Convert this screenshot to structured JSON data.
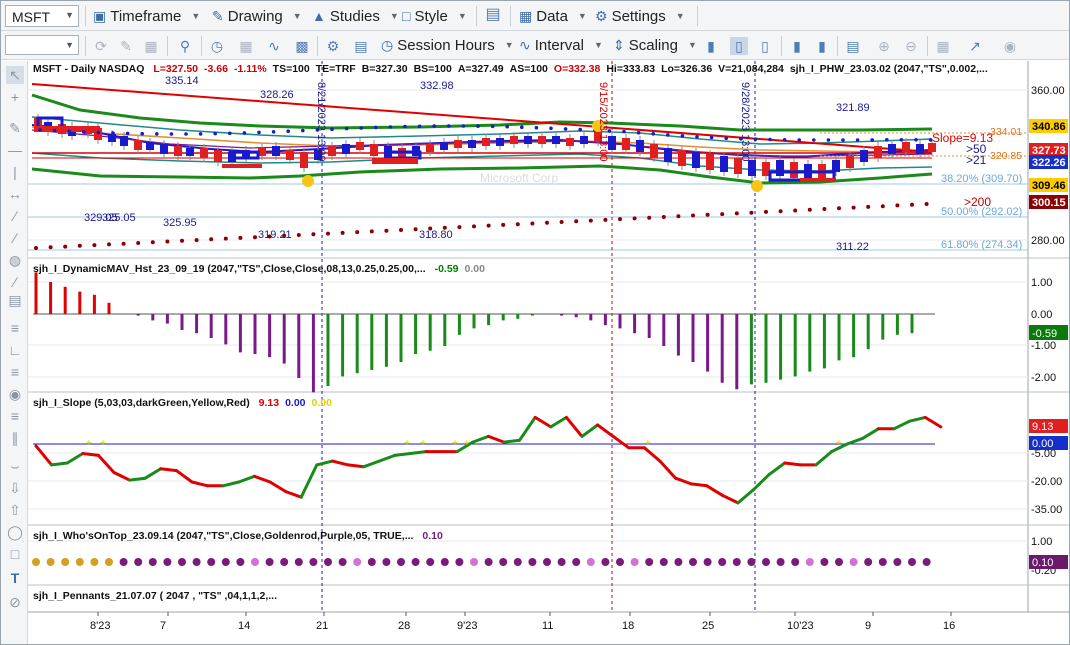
{
  "toolbar1": {
    "symbol": "MSFT",
    "menus": [
      {
        "name": "timeframe-menu",
        "icon": "calendar-icon",
        "label": "Timeframe"
      },
      {
        "name": "drawing-menu",
        "icon": "pencil-icon",
        "label": "Drawing"
      },
      {
        "name": "studies-menu",
        "icon": "flask-icon",
        "label": "Studies"
      },
      {
        "name": "style-menu",
        "icon": "style-icon",
        "label": "Style"
      },
      {
        "name": "data-menu",
        "icon": "table-icon",
        "label": "Data"
      },
      {
        "name": "settings-menu",
        "icon": "gear-icon",
        "label": "Settings"
      }
    ]
  },
  "toolbar2": {
    "session_label": "Session Hours",
    "interval_label": "Interval",
    "scaling_label": "Scaling"
  },
  "price_pane": {
    "title": "MSFT - Daily  NASDAQ",
    "stats": [
      {
        "text": "L=327.50",
        "color": "#d00000"
      },
      {
        "text": "-3.66",
        "color": "#d00000"
      },
      {
        "text": "-1.11%",
        "color": "#d00000"
      },
      {
        "text": "TS=100",
        "color": "#111"
      },
      {
        "text": "TE=TRF",
        "color": "#111"
      },
      {
        "text": "B=327.30",
        "color": "#111"
      },
      {
        "text": "BS=100",
        "color": "#111"
      },
      {
        "text": "A=327.49",
        "color": "#111"
      },
      {
        "text": "AS=100",
        "color": "#111"
      },
      {
        "text": "O=332.38",
        "color": "#d00000"
      },
      {
        "text": "Hi=333.83",
        "color": "#111"
      },
      {
        "text": "Lo=326.36",
        "color": "#111"
      },
      {
        "text": "V=21,084,284",
        "color": "#111"
      },
      {
        "text": "sjh_I_PHW_23.03.02 (2047,\"TS\",0.002,...",
        "color": "#111"
      }
    ],
    "watermark": "Microsoft Corp",
    "axis_ticks": [
      "360.00",
      "280.00"
    ],
    "price_labels": [
      {
        "text": "335.14",
        "color": "#1a1a8c"
      },
      {
        "text": "328.26",
        "color": "#1a1a8c"
      },
      {
        "text": "332.98",
        "color": "#1a1a8c"
      },
      {
        "text": "321.89",
        "color": "#1a1a8c"
      },
      {
        "text": "329.05",
        "color": "#1a1a8c"
      },
      {
        "text": "325.05",
        "color": "#1a1a8c"
      },
      {
        "text": "325.95",
        "color": "#1a1a8c"
      },
      {
        "text": "319.21",
        "color": "#1a1a8c"
      },
      {
        "text": "318.80",
        "color": "#1a1a8c"
      },
      {
        "text": "311.22",
        "color": "#1a1a8c"
      }
    ],
    "date_marks": [
      "8/21/2023 13:00",
      "9/15/2023 13:00",
      "9/28/2023 13:00"
    ],
    "fib_labels": [
      "38.20% (309.70)",
      "50.00% (292.02)",
      "61.80% (274.34)"
    ],
    "line_labels": [
      {
        "text": "334.01",
        "color": "#e0721a"
      },
      {
        "text": "320.85",
        "color": "#e0721a"
      }
    ],
    "annotations": [
      {
        "text": "Slope=9.13",
        "color": "#e00000"
      },
      {
        "text": ">21",
        "color": "#1a1a8c"
      },
      {
        "text": ">50",
        "color": "#1a1a8c"
      },
      {
        "text": ">200",
        "color": "#c00000"
      }
    ],
    "value_badges": [
      {
        "text": "340.86",
        "bg": "#ffcc00",
        "fg": "#000"
      },
      {
        "text": "327.73",
        "bg": "#e02020",
        "fg": "#fff"
      },
      {
        "text": "322.26",
        "bg": "#1530c8",
        "fg": "#fff"
      },
      {
        "text": "309.46",
        "bg": "#ffcc00",
        "fg": "#000"
      },
      {
        "text": "300.15",
        "bg": "#8b0000",
        "fg": "#fff"
      }
    ]
  },
  "histogram_pane": {
    "title": "sjh_I_DynamicMAV_Hst_23_09_19 (2047,\"TS\",Close,Close,08,13,0.25,0.25,00,...",
    "values": [
      {
        "text": "-0.59",
        "color": "#008000"
      },
      {
        "text": "0.00",
        "color": "#888888"
      }
    ],
    "axis_ticks": [
      "1.00",
      "0.00",
      "-1.00",
      "-2.00"
    ],
    "badge": {
      "text": "-0.59",
      "bg": "#0a7a0a",
      "fg": "#fff"
    }
  },
  "slope_pane": {
    "title": "sjh_I_Slope (5,03,03,darkGreen,Yellow,Red)",
    "values": [
      {
        "text": "9.13",
        "color": "#e00000"
      },
      {
        "text": "0.00",
        "color": "#1a1acc"
      },
      {
        "text": "0.00",
        "color": "#e6d000"
      }
    ],
    "axis_ticks": [
      "5.00",
      "-5.00",
      "-20.00",
      "-35.00"
    ],
    "badges": [
      {
        "text": "9.13",
        "bg": "#e02020",
        "fg": "#fff"
      },
      {
        "text": "0.00",
        "bg": "#1530c8",
        "fg": "#fff"
      }
    ]
  },
  "whos_pane": {
    "title": "sjh_I_Who'sOnTop_23.09.14 (2047,\"TS\",Close,Goldenrod,Purple,05,  TRUE,...",
    "values": [
      {
        "text": "0.10",
        "color": "#7a1a7a"
      }
    ],
    "axis_ticks": [
      "1.00",
      "-0.20"
    ],
    "badge": {
      "text": "0.10",
      "bg": "#6a1a6a",
      "fg": "#fff"
    }
  },
  "pennants_pane": {
    "title": "sjh_I_Pennants_21.07.07 (  2047 ,  \"TS\" ,04,1,1,2,..."
  },
  "time_axis": [
    "8'23",
    "7",
    "14",
    "21",
    "28",
    "9'23",
    "11",
    "18",
    "25",
    "10'23",
    "9",
    "16"
  ],
  "colors": {
    "green": "#1a8a1a",
    "teal": "#1f8a8a",
    "blue": "#1a1acc",
    "red": "#e00000",
    "orange": "#e09030",
    "purple": "#7a1a8a",
    "darkred": "#8b0000"
  },
  "chart_data": {
    "type": "line",
    "slope_series": {
      "values": [
        -1,
        -11,
        -10,
        -5,
        -6,
        -15,
        -19,
        -18,
        -13,
        -14,
        -20,
        -22,
        -22,
        -20,
        -17,
        -20,
        -25,
        -28,
        -11,
        -9,
        -11,
        -12,
        -9,
        -6,
        -5,
        -4,
        -4,
        -4,
        1,
        4,
        1,
        2,
        14,
        9,
        14,
        4,
        10,
        4,
        -2,
        -2,
        -9,
        -18,
        -21,
        -22,
        -27,
        -31,
        -24,
        -16,
        -10,
        -11,
        -11,
        -4,
        0,
        3,
        8,
        8,
        12,
        14,
        9
      ]
    },
    "histogram": {
      "values": [
        1.3,
        1.0,
        0.85,
        0.7,
        0.6,
        0.35,
        0.0,
        -0.05,
        -0.2,
        -0.3,
        -0.5,
        -0.6,
        -0.75,
        -0.95,
        -1.2,
        -1.25,
        -1.35,
        -1.55,
        -2.0,
        -2.45,
        -2.25,
        -1.95,
        -1.85,
        -1.75,
        -1.65,
        -1.5,
        -1.25,
        -1.15,
        -1.0,
        -0.65,
        -0.45,
        -0.35,
        -0.2,
        -0.15,
        -0.05,
        0.0,
        -0.05,
        -0.1,
        -0.2,
        -0.35,
        -0.45,
        -0.6,
        -0.75,
        -1.0,
        -1.3,
        -1.5,
        -1.8,
        -2.15,
        -2.35,
        -2.2,
        -2.15,
        -2.05,
        -1.95,
        -1.8,
        -1.7,
        -1.45,
        -1.35,
        -1.1,
        -0.8,
        -0.65,
        -0.6
      ]
    }
  }
}
